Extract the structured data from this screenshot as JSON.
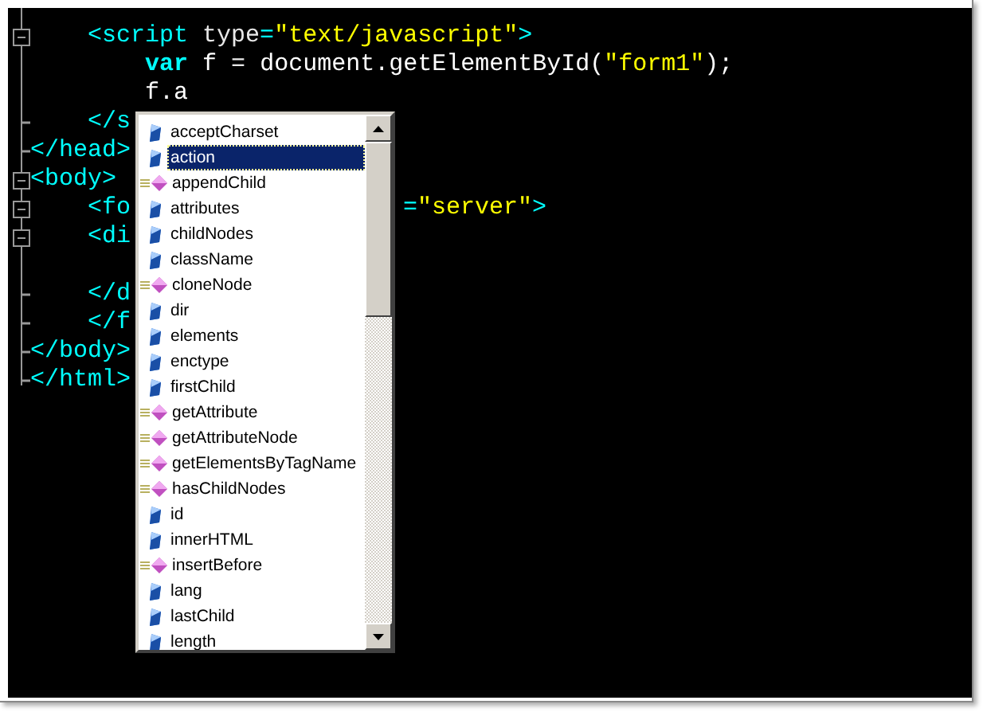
{
  "editor": {
    "lines": [
      {
        "kind": "fold_start",
        "tokens": [
          {
            "kind": "tag",
            "text": "    <script"
          },
          {
            "kind": "attr",
            "text": " type"
          },
          {
            "kind": "tag",
            "text": "="
          },
          {
            "kind": "string",
            "text": "\"text/javascript\""
          },
          {
            "kind": "tag",
            "text": ">"
          }
        ]
      },
      {
        "kind": "plain",
        "tokens": [
          {
            "kind": "keyword",
            "text": "        var"
          },
          {
            "kind": "text",
            "text": " f "
          },
          {
            "kind": "attr",
            "text": "="
          },
          {
            "kind": "text",
            "text": " document.getElementById("
          },
          {
            "kind": "string",
            "text": "\"form1\""
          },
          {
            "kind": "text",
            "text": ");"
          }
        ]
      },
      {
        "kind": "plain",
        "tokens": [
          {
            "kind": "text",
            "text": "        f.a"
          }
        ]
      },
      {
        "kind": "fold_end",
        "tokens": [
          {
            "kind": "tag",
            "text": "    </s"
          }
        ]
      },
      {
        "kind": "fold_end",
        "tokens": [
          {
            "kind": "tag",
            "text": "</head>"
          }
        ]
      },
      {
        "kind": "fold_start",
        "tokens": [
          {
            "kind": "tag",
            "text": "<body>"
          }
        ]
      },
      {
        "kind": "fold_start",
        "tokens": [
          {
            "kind": "tag",
            "text": "    <fo"
          }
        ],
        "after": [
          {
            "kind": "tag",
            "text": "="
          },
          {
            "kind": "string",
            "text": "\"server\""
          },
          {
            "kind": "tag",
            "text": ">"
          }
        ]
      },
      {
        "kind": "fold_start",
        "tokens": [
          {
            "kind": "tag",
            "text": "    <di"
          }
        ]
      },
      {
        "kind": "blank"
      },
      {
        "kind": "fold_end",
        "tokens": [
          {
            "kind": "tag",
            "text": "    </d"
          }
        ]
      },
      {
        "kind": "fold_end",
        "tokens": [
          {
            "kind": "tag",
            "text": "    </f"
          }
        ]
      },
      {
        "kind": "fold_end",
        "tokens": [
          {
            "kind": "tag",
            "text": "</body>"
          }
        ]
      },
      {
        "kind": "fold_end",
        "tokens": [
          {
            "kind": "tag",
            "text": "</html>"
          }
        ]
      }
    ]
  },
  "completion": {
    "items": [
      {
        "kind": "property",
        "label": "acceptCharset",
        "selected": false
      },
      {
        "kind": "property",
        "label": "action",
        "selected": true
      },
      {
        "kind": "method",
        "label": "appendChild",
        "selected": false
      },
      {
        "kind": "property",
        "label": "attributes",
        "selected": false
      },
      {
        "kind": "property",
        "label": "childNodes",
        "selected": false
      },
      {
        "kind": "property",
        "label": "className",
        "selected": false
      },
      {
        "kind": "method",
        "label": "cloneNode",
        "selected": false
      },
      {
        "kind": "property",
        "label": "dir",
        "selected": false
      },
      {
        "kind": "property",
        "label": "elements",
        "selected": false
      },
      {
        "kind": "property",
        "label": "enctype",
        "selected": false
      },
      {
        "kind": "property",
        "label": "firstChild",
        "selected": false
      },
      {
        "kind": "method",
        "label": "getAttribute",
        "selected": false
      },
      {
        "kind": "method",
        "label": "getAttributeNode",
        "selected": false
      },
      {
        "kind": "method",
        "label": "getElementsByTagName",
        "selected": false
      },
      {
        "kind": "method",
        "label": "hasChildNodes",
        "selected": false
      },
      {
        "kind": "property",
        "label": "id",
        "selected": false
      },
      {
        "kind": "property",
        "label": "innerHTML",
        "selected": false
      },
      {
        "kind": "method",
        "label": "insertBefore",
        "selected": false
      },
      {
        "kind": "property",
        "label": "lang",
        "selected": false
      },
      {
        "kind": "property",
        "label": "lastChild",
        "selected": false
      },
      {
        "kind": "property",
        "label": "length",
        "selected": false
      }
    ]
  }
}
